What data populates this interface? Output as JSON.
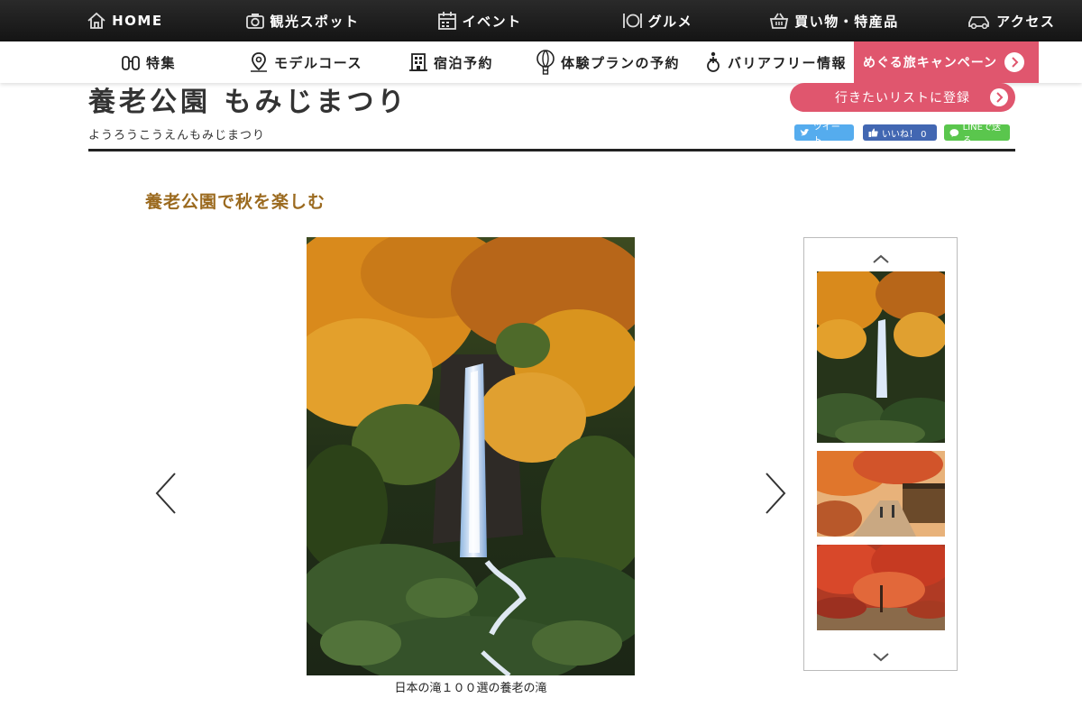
{
  "top_nav": [
    {
      "label": "HOME",
      "icon": "home-icon"
    },
    {
      "label": "観光スポット",
      "icon": "camera-icon"
    },
    {
      "label": "イベント",
      "icon": "calendar-icon"
    },
    {
      "label": "グルメ",
      "icon": "cutlery-icon"
    },
    {
      "label": "買い物・特産品",
      "icon": "basket-icon"
    },
    {
      "label": "アクセス",
      "icon": "car-icon"
    }
  ],
  "sub_nav": [
    {
      "label": "特集",
      "icon": "binoculars-icon"
    },
    {
      "label": "モデルコース",
      "icon": "map-pin-icon"
    },
    {
      "label": "宿泊予約",
      "icon": "hotel-icon"
    },
    {
      "label": "体験プランの予約",
      "icon": "balloon-icon"
    },
    {
      "label": "バリアフリー情報",
      "icon": "accessibility-icon"
    }
  ],
  "campaign_label": "めぐる旅キャンペーン",
  "page": {
    "title": "養老公園 もみじまつり",
    "reading": "ようろうこうえんもみじまつり",
    "wishlist_label": "行きたいリストに登録",
    "share": {
      "tweet": "ツイート",
      "like": "いいね！ 0",
      "line": "LINEで送る"
    },
    "section_heading": "養老公園で秋を楽しむ"
  },
  "gallery": {
    "caption": "日本の滝１００選の養老の滝"
  },
  "colors": {
    "accent": "#e0566e",
    "heading": "#9b6a1f",
    "nav_bg": "#1c1c1c"
  }
}
